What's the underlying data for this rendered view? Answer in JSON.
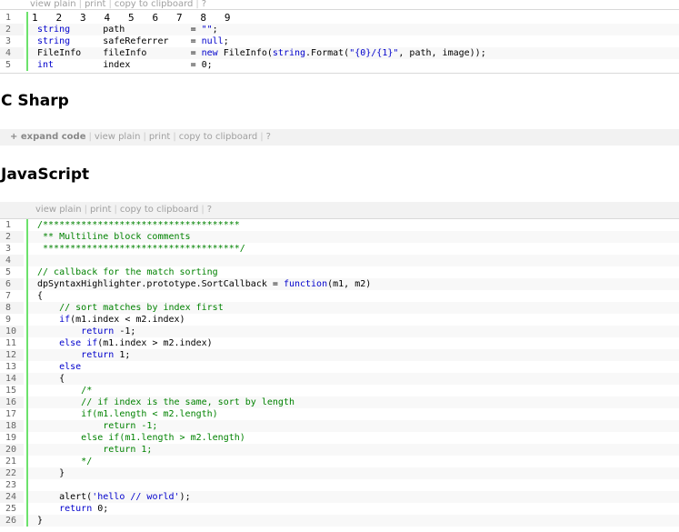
{
  "block1": {
    "toolbar": [
      "view plain",
      "print",
      "copy to clipboard",
      "?"
    ],
    "ruler": "1   2   3   4   5   6   7   8   9",
    "lines": [
      {
        "n": "1",
        "parts": []
      },
      {
        "n": "2",
        "parts": [
          {
            "c": "kw",
            "t": "string"
          },
          {
            "t": "      path            = "
          },
          {
            "c": "st",
            "t": "\"\""
          },
          {
            "t": ";"
          }
        ]
      },
      {
        "n": "3",
        "parts": [
          {
            "c": "kw",
            "t": "string"
          },
          {
            "t": "      safeReferrer    = "
          },
          {
            "c": "kw",
            "t": "null"
          },
          {
            "t": ";"
          }
        ]
      },
      {
        "n": "4",
        "parts": [
          {
            "t": "FileInfo    fileInfo        = "
          },
          {
            "c": "kw",
            "t": "new"
          },
          {
            "t": " FileInfo("
          },
          {
            "c": "kw",
            "t": "string"
          },
          {
            "t": ".Format("
          },
          {
            "c": "st",
            "t": "\"{0}/{1}\""
          },
          {
            "t": ", path, image));"
          }
        ]
      },
      {
        "n": "5",
        "parts": [
          {
            "c": "kw",
            "t": "int"
          },
          {
            "t": "         index           = 0;"
          }
        ]
      }
    ]
  },
  "csharp_heading": "C Sharp",
  "block2": {
    "toolbar": [
      "+ expand code",
      "view plain",
      "print",
      "copy to clipboard",
      "?"
    ]
  },
  "javascript_heading": "JavaScript",
  "block3": {
    "toolbar": [
      "view plain",
      "print",
      "copy to clipboard",
      "?"
    ],
    "lines": [
      {
        "n": "1",
        "parts": [
          {
            "c": "cm",
            "t": "/************************************"
          }
        ]
      },
      {
        "n": "2",
        "parts": [
          {
            "c": "cm",
            "t": " ** Multiline block comments"
          }
        ]
      },
      {
        "n": "3",
        "parts": [
          {
            "c": "cm",
            "t": " ************************************/"
          }
        ]
      },
      {
        "n": "4",
        "parts": []
      },
      {
        "n": "5",
        "parts": [
          {
            "c": "cm",
            "t": "// callback for the match sorting"
          }
        ]
      },
      {
        "n": "6",
        "parts": [
          {
            "t": "dpSyntaxHighlighter.prototype.SortCallback = "
          },
          {
            "c": "kw",
            "t": "function"
          },
          {
            "t": "(m1, m2)"
          }
        ]
      },
      {
        "n": "7",
        "parts": [
          {
            "t": "{"
          }
        ]
      },
      {
        "n": "8",
        "parts": [
          {
            "t": "    "
          },
          {
            "c": "cm",
            "t": "// sort matches by index first"
          }
        ]
      },
      {
        "n": "9",
        "parts": [
          {
            "t": "    "
          },
          {
            "c": "kw",
            "t": "if"
          },
          {
            "t": "(m1.index < m2.index)"
          }
        ]
      },
      {
        "n": "10",
        "parts": [
          {
            "t": "        "
          },
          {
            "c": "kw",
            "t": "return"
          },
          {
            "t": " -1;"
          }
        ]
      },
      {
        "n": "11",
        "parts": [
          {
            "t": "    "
          },
          {
            "c": "kw",
            "t": "else if"
          },
          {
            "t": "(m1.index > m2.index)"
          }
        ]
      },
      {
        "n": "12",
        "parts": [
          {
            "t": "        "
          },
          {
            "c": "kw",
            "t": "return"
          },
          {
            "t": " 1;"
          }
        ]
      },
      {
        "n": "13",
        "parts": [
          {
            "t": "    "
          },
          {
            "c": "kw",
            "t": "else"
          }
        ]
      },
      {
        "n": "14",
        "parts": [
          {
            "t": "    {"
          }
        ]
      },
      {
        "n": "15",
        "parts": [
          {
            "t": "        "
          },
          {
            "c": "cm",
            "t": "/*"
          }
        ]
      },
      {
        "n": "16",
        "parts": [
          {
            "t": "        "
          },
          {
            "c": "cm",
            "t": "// if index is the same, sort by length"
          }
        ]
      },
      {
        "n": "17",
        "parts": [
          {
            "t": "        "
          },
          {
            "c": "cm",
            "t": "if(m1.length < m2.length)"
          }
        ]
      },
      {
        "n": "18",
        "parts": [
          {
            "t": "            "
          },
          {
            "c": "cm",
            "t": "return -1;"
          }
        ]
      },
      {
        "n": "19",
        "parts": [
          {
            "t": "        "
          },
          {
            "c": "cm",
            "t": "else if(m1.length > m2.length)"
          }
        ]
      },
      {
        "n": "20",
        "parts": [
          {
            "t": "            "
          },
          {
            "c": "cm",
            "t": "return 1;"
          }
        ]
      },
      {
        "n": "21",
        "parts": [
          {
            "t": "        "
          },
          {
            "c": "cm",
            "t": "*/"
          }
        ]
      },
      {
        "n": "22",
        "parts": [
          {
            "t": "    }"
          }
        ]
      },
      {
        "n": "23",
        "parts": []
      },
      {
        "n": "24",
        "parts": [
          {
            "t": "    alert("
          },
          {
            "c": "st",
            "t": "'hello // world'"
          },
          {
            "t": ");"
          }
        ]
      },
      {
        "n": "25",
        "parts": [
          {
            "t": "    "
          },
          {
            "c": "kw",
            "t": "return"
          },
          {
            "t": " 0;"
          }
        ]
      },
      {
        "n": "26",
        "parts": [
          {
            "t": "}"
          }
        ]
      }
    ]
  },
  "colors": {
    "keyword": "#0000cc",
    "comment": "#008200",
    "gutter_border": "#6ce26c"
  }
}
